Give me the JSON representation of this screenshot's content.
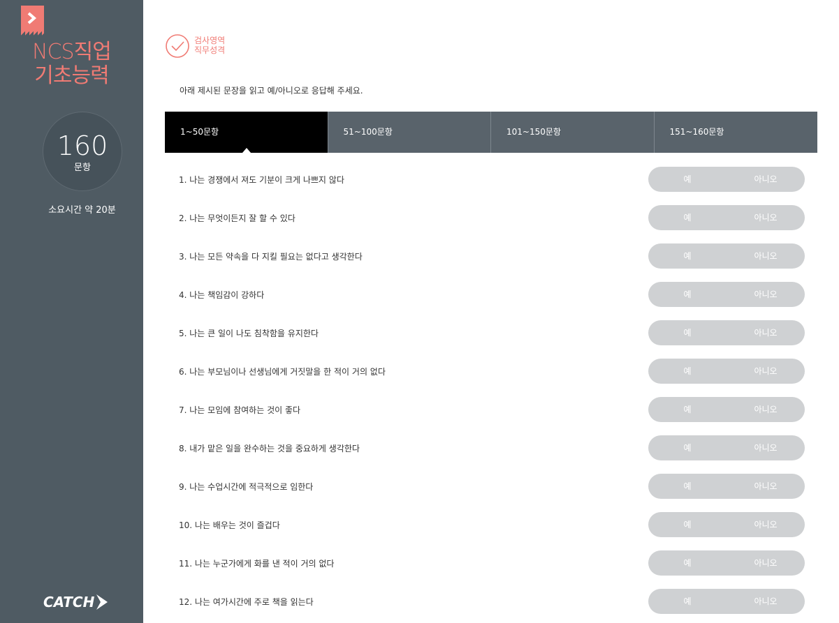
{
  "sidebar": {
    "title_line1": "NCS직업",
    "title_line2": "기초능력",
    "question_count": "160",
    "question_unit": "문항",
    "time_label": "소요시간 약 20분",
    "logo_text": "CATCH"
  },
  "section": {
    "label1": "검사영역",
    "label2": "직무성격"
  },
  "instruction": "아래 제시된 문장을 읽고 예/아니오로 응답해 주세요.",
  "tabs": [
    {
      "label": "1~50문항",
      "active": true
    },
    {
      "label": "51~100문항",
      "active": false
    },
    {
      "label": "101~150문항",
      "active": false
    },
    {
      "label": "151~160문항",
      "active": false
    }
  ],
  "answer_labels": {
    "yes": "예",
    "no": "아니오"
  },
  "questions": [
    "1. 나는 경쟁에서 져도 기분이 크게 나쁘지 않다",
    "2. 나는 무엇이든지 잘 할 수 있다",
    "3. 나는 모든 약속을 다 지킬 필요는 없다고 생각한다",
    "4. 나는 책임감이 강하다",
    "5. 나는 큰 일이 나도 침착함을 유지한다",
    "6. 나는 부모님이나 선생님에게 거짓말을 한 적이 거의 없다",
    "7. 나는 모임에 참여하는 것이 좋다",
    "8. 내가 맡은 일을 완수하는 것을 중요하게 생각한다",
    "9. 나는 수업시간에 적극적으로 임한다",
    "10. 나는 배우는 것이 즐겁다",
    "11. 나는 누군가에게 화를 낸 적이 거의 없다",
    "12. 나는 여가시간에 주로 책을 읽는다"
  ],
  "colors": {
    "accent": "#f07b74",
    "sidebar_bg": "#4f5b63",
    "tab_bg": "#59636b",
    "tab_active_bg": "#000000",
    "toggle_bg": "#cfd1d3"
  }
}
